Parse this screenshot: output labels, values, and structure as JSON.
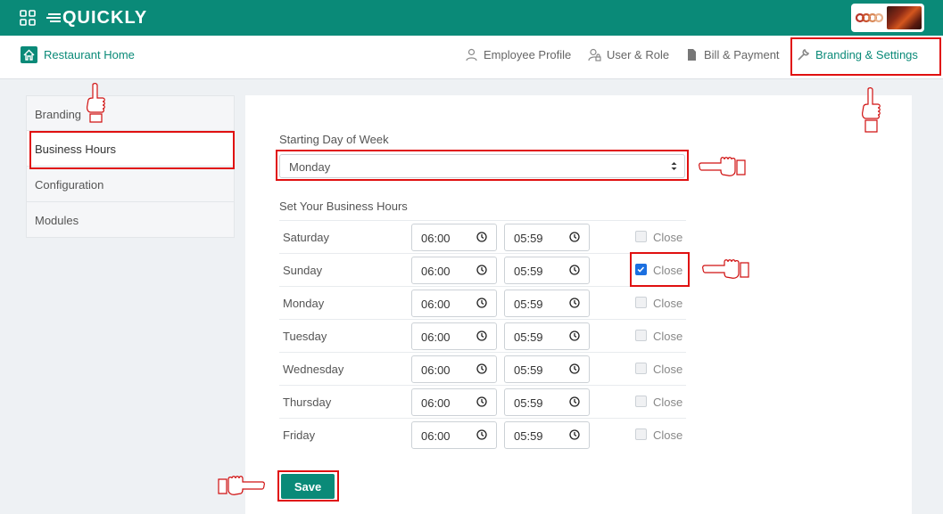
{
  "app": {
    "logo_text": "QUICKLY"
  },
  "nav": {
    "home_label": "Restaurant Home",
    "items": [
      {
        "label": "Employee Profile",
        "icon": "person-icon"
      },
      {
        "label": "User & Role",
        "icon": "user-lock-icon"
      },
      {
        "label": "Bill & Payment",
        "icon": "document-icon"
      },
      {
        "label": "Branding & Settings",
        "icon": "wrench-icon",
        "active": true
      }
    ]
  },
  "sidebar": {
    "items": [
      {
        "label": "Branding"
      },
      {
        "label": "Business Hours",
        "active": true
      },
      {
        "label": "Configuration"
      },
      {
        "label": "Modules"
      }
    ]
  },
  "form": {
    "start_day_label": "Starting Day of Week",
    "start_day_value": "Monday",
    "hours_label": "Set Your Business Hours",
    "close_label": "Close",
    "days": [
      {
        "day": "Saturday",
        "open": "06:00",
        "close": "05:59",
        "closed": false
      },
      {
        "day": "Sunday",
        "open": "06:00",
        "close": "05:59",
        "closed": true
      },
      {
        "day": "Monday",
        "open": "06:00",
        "close": "05:59",
        "closed": false
      },
      {
        "day": "Tuesday",
        "open": "06:00",
        "close": "05:59",
        "closed": false
      },
      {
        "day": "Wednesday",
        "open": "06:00",
        "close": "05:59",
        "closed": false
      },
      {
        "day": "Thursday",
        "open": "06:00",
        "close": "05:59",
        "closed": false
      },
      {
        "day": "Friday",
        "open": "06:00",
        "close": "05:59",
        "closed": false
      }
    ],
    "save_label": "Save"
  },
  "colors": {
    "brand": "#0a8a78",
    "annotation": "#e01010",
    "checkbox": "#1b6fe0"
  }
}
